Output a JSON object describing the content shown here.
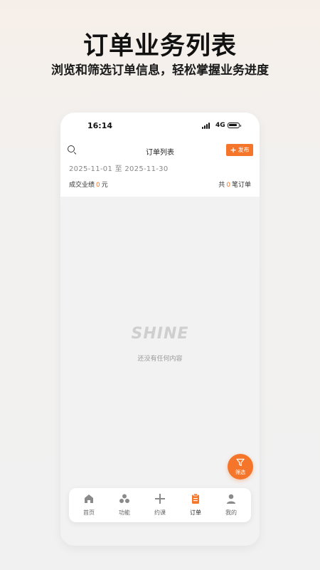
{
  "promo": {
    "title": "订单业务列表",
    "subtitle": "浏览和筛选订单信息，轻松掌握业务进度"
  },
  "status_bar": {
    "time": "16:14",
    "network": "4G"
  },
  "header": {
    "title": "订单列表",
    "new_button": "发布",
    "date_range": "2025-11-01 至 2025-11-30",
    "summary": {
      "revenue_label": "成交业绩",
      "revenue_value": "0",
      "revenue_unit": "元",
      "count_prefix": "共",
      "count_value": "0",
      "count_suffix": "笔订单"
    }
  },
  "empty_state": {
    "logo_text": "SHINE",
    "message": "还没有任何内容"
  },
  "filter_button": {
    "label": "筛选"
  },
  "tabbar": {
    "items": [
      {
        "label": "首页",
        "icon": "home-icon"
      },
      {
        "label": "功能",
        "icon": "apps-icon"
      },
      {
        "label": "约课",
        "icon": "plus-icon"
      },
      {
        "label": "订单",
        "icon": "order-icon",
        "active": true
      },
      {
        "label": "我的",
        "icon": "user-icon"
      }
    ]
  },
  "colors": {
    "accent": "#f5762a",
    "page_bg": "#f2f2f2",
    "text": "#222222",
    "muted": "#9a9a9a"
  }
}
